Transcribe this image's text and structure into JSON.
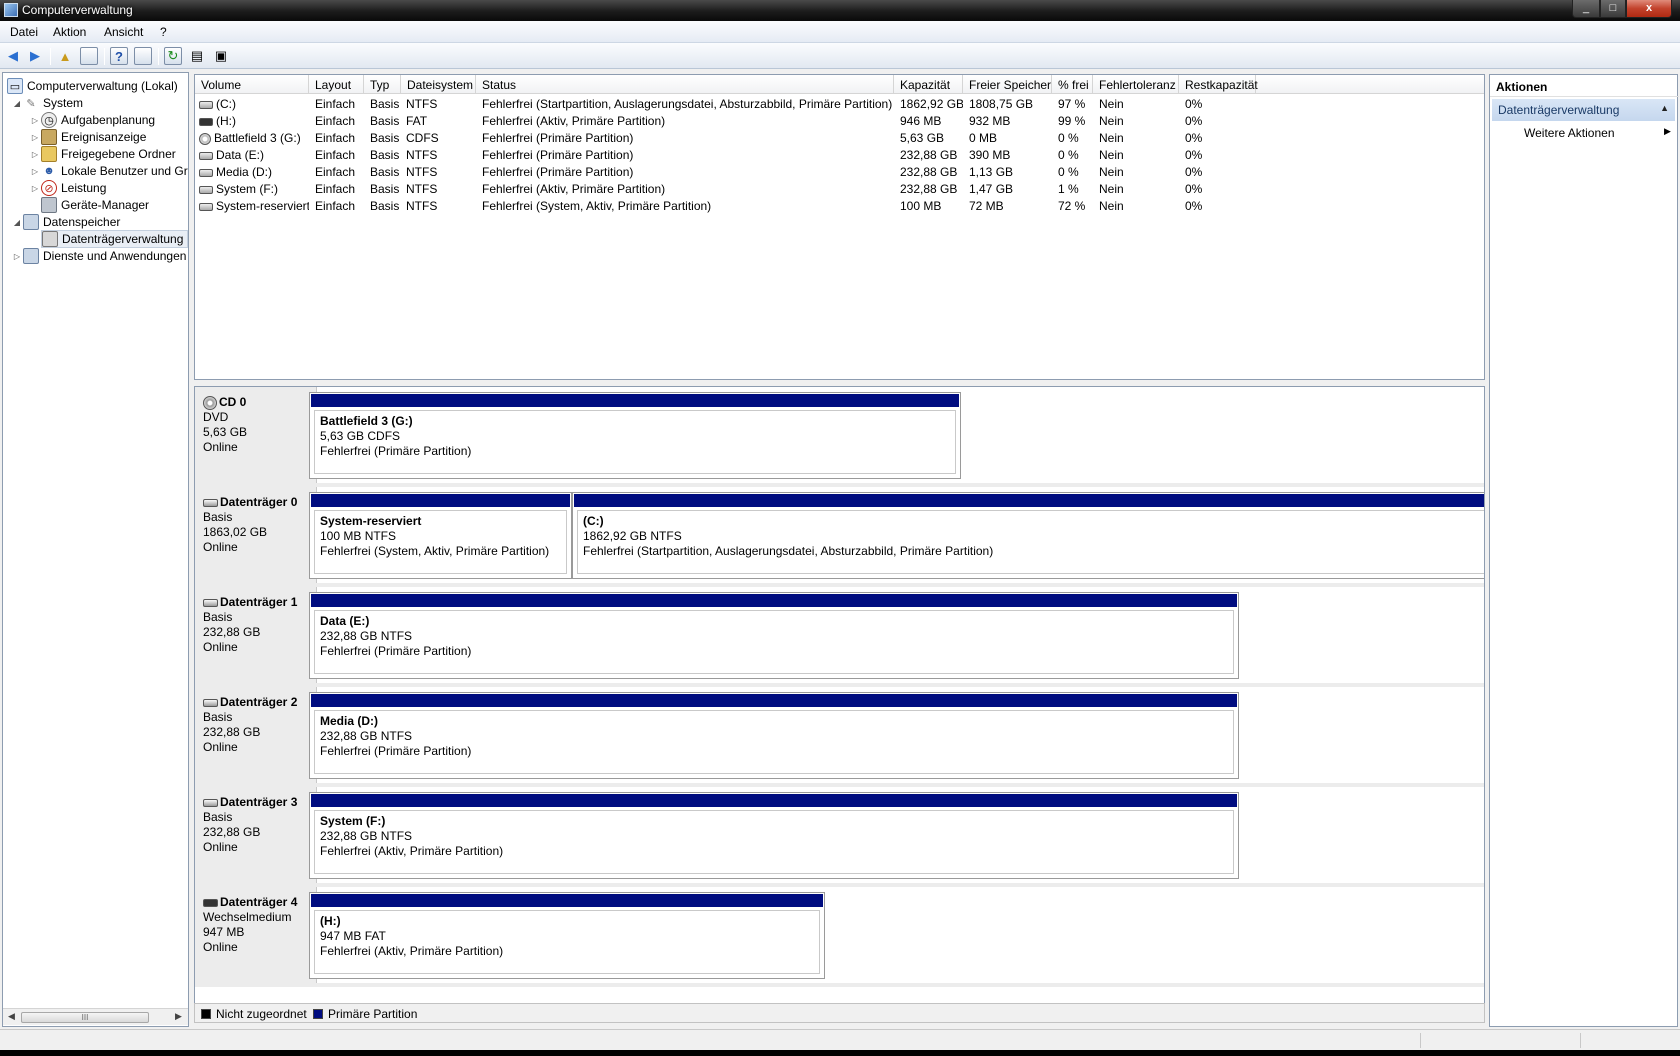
{
  "window": {
    "title": "Computerverwaltung",
    "min": "_",
    "max": "□",
    "close": "x"
  },
  "menu": [
    "Datei",
    "Aktion",
    "Ansicht",
    "?"
  ],
  "tree": [
    {
      "label": "Computerverwaltung (Lokal)",
      "icon": "computer-icon"
    },
    {
      "label": "System",
      "icon": "tools-icon"
    },
    {
      "label": "Aufgabenplanung",
      "icon": "clock-icon"
    },
    {
      "label": "Ereignisanzeige",
      "icon": "event-viewer-icon"
    },
    {
      "label": "Freigegebene Ordner",
      "icon": "shared-folder-icon"
    },
    {
      "label": "Lokale Benutzer und Gr",
      "icon": "users-icon"
    },
    {
      "label": "Leistung",
      "icon": "performance-icon"
    },
    {
      "label": "Geräte-Manager",
      "icon": "device-manager-icon"
    },
    {
      "label": "Datenspeicher",
      "icon": "storage-icon"
    },
    {
      "label": "Datenträgerverwaltung",
      "icon": "disk-management-icon"
    },
    {
      "label": "Dienste und Anwendungen",
      "icon": "services-icon"
    }
  ],
  "scrollbar": {
    "grip": "III"
  },
  "columns": [
    "Volume",
    "Layout",
    "Typ",
    "Dateisystem",
    "Status",
    "Kapazität",
    "Freier Speicher",
    "% frei",
    "Fehlertoleranz",
    "Restkapazität"
  ],
  "volumes": [
    {
      "volume": "(C:)",
      "layout": "Einfach",
      "typ": "Basis",
      "fs": "NTFS",
      "status": "Fehlerfrei (Startpartition, Auslagerungsdatei, Absturzabbild, Primäre Partition)",
      "cap": "1862,92 GB",
      "free": "1808,75 GB",
      "pct": "97 %",
      "ft": "Nein",
      "rest": "0%"
    },
    {
      "volume": "(H:)",
      "layout": "Einfach",
      "typ": "Basis",
      "fs": "FAT",
      "status": "Fehlerfrei (Aktiv, Primäre Partition)",
      "cap": "946 MB",
      "free": "932 MB",
      "pct": "99 %",
      "ft": "Nein",
      "rest": "0%"
    },
    {
      "volume": "Battlefield 3 (G:)",
      "layout": "Einfach",
      "typ": "Basis",
      "fs": "CDFS",
      "status": "Fehlerfrei (Primäre Partition)",
      "cap": "5,63 GB",
      "free": "0 MB",
      "pct": "0 %",
      "ft": "Nein",
      "rest": "0%"
    },
    {
      "volume": "Data (E:)",
      "layout": "Einfach",
      "typ": "Basis",
      "fs": "NTFS",
      "status": "Fehlerfrei (Primäre Partition)",
      "cap": "232,88 GB",
      "free": "390 MB",
      "pct": "0 %",
      "ft": "Nein",
      "rest": "0%"
    },
    {
      "volume": "Media (D:)",
      "layout": "Einfach",
      "typ": "Basis",
      "fs": "NTFS",
      "status": "Fehlerfrei (Primäre Partition)",
      "cap": "232,88 GB",
      "free": "1,13 GB",
      "pct": "0 %",
      "ft": "Nein",
      "rest": "0%"
    },
    {
      "volume": "System (F:)",
      "layout": "Einfach",
      "typ": "Basis",
      "fs": "NTFS",
      "status": "Fehlerfrei (Aktiv, Primäre Partition)",
      "cap": "232,88 GB",
      "free": "1,47 GB",
      "pct": "1 %",
      "ft": "Nein",
      "rest": "0%"
    },
    {
      "volume": "System-reserviert",
      "layout": "Einfach",
      "typ": "Basis",
      "fs": "NTFS",
      "status": "Fehlerfrei (System, Aktiv, Primäre Partition)",
      "cap": "100 MB",
      "free": "72 MB",
      "pct": "72 %",
      "ft": "Nein",
      "rest": "0%"
    }
  ],
  "disks": [
    {
      "name": "CD 0",
      "type": "DVD",
      "size": "5,63 GB",
      "state": "Online",
      "parts": [
        {
          "name": "Battlefield 3  (G:)",
          "size": "5,63 GB CDFS",
          "status": "Fehlerfrei (Primäre Partition)"
        }
      ]
    },
    {
      "name": "Datenträger 0",
      "type": "Basis",
      "size": "1863,02 GB",
      "state": "Online",
      "parts": [
        {
          "name": "System-reserviert",
          "size": "100 MB NTFS",
          "status": "Fehlerfrei (System, Aktiv, Primäre Partition)"
        },
        {
          "name": "(C:)",
          "size": "1862,92 GB NTFS",
          "status": "Fehlerfrei (Startpartition, Auslagerungsdatei, Absturzabbild, Primäre Partition)"
        }
      ]
    },
    {
      "name": "Datenträger 1",
      "type": "Basis",
      "size": "232,88 GB",
      "state": "Online",
      "parts": [
        {
          "name": "Data  (E:)",
          "size": "232,88 GB NTFS",
          "status": "Fehlerfrei (Primäre Partition)"
        }
      ]
    },
    {
      "name": "Datenträger 2",
      "type": "Basis",
      "size": "232,88 GB",
      "state": "Online",
      "parts": [
        {
          "name": "Media  (D:)",
          "size": "232,88 GB NTFS",
          "status": "Fehlerfrei (Primäre Partition)"
        }
      ]
    },
    {
      "name": "Datenträger 3",
      "type": "Basis",
      "size": "232,88 GB",
      "state": "Online",
      "parts": [
        {
          "name": "System  (F:)",
          "size": "232,88 GB NTFS",
          "status": "Fehlerfrei (Aktiv, Primäre Partition)"
        }
      ]
    },
    {
      "name": "Datenträger 4",
      "type": "Wechselmedium",
      "size": "947 MB",
      "state": "Online",
      "parts": [
        {
          "name": "(H:)",
          "size": "947 MB FAT",
          "status": "Fehlerfrei (Aktiv, Primäre Partition)"
        }
      ]
    }
  ],
  "legend": {
    "unallocated": "Nicht zugeordnet",
    "primary": "Primäre Partition"
  },
  "actions": {
    "header": "Aktionen",
    "section": "Datenträgerverwaltung",
    "more": "Weitere Aktionen"
  },
  "colors": {
    "primary_partition": "#000c80",
    "unallocated": "#000000"
  }
}
